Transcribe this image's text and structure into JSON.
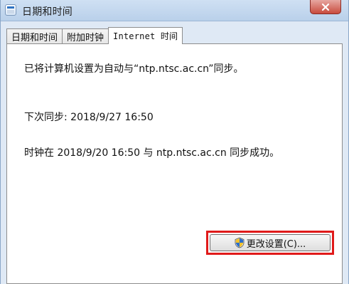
{
  "window": {
    "title": "日期和时间"
  },
  "tabs": [
    {
      "label": "日期和时间",
      "active": false
    },
    {
      "label": "附加时钟",
      "active": false
    },
    {
      "label": "Internet 时间",
      "active": true
    }
  ],
  "content": {
    "sync_setting": "已将计算机设置为自动与“ntp.ntsc.ac.cn”同步。",
    "next_sync": "下次同步: 2018/9/27 16:50",
    "last_sync": "时钟在 2018/9/20 16:50 与 ntp.ntsc.ac.cn 同步成功。"
  },
  "buttons": {
    "change_settings": "更改设置(C)..."
  },
  "icons": {
    "window_icon": "calendar-clock-icon",
    "close": "close-icon",
    "shield": "uac-shield-icon"
  },
  "colors": {
    "highlight": "#e01a1a",
    "close_button": "#c84b3d"
  }
}
